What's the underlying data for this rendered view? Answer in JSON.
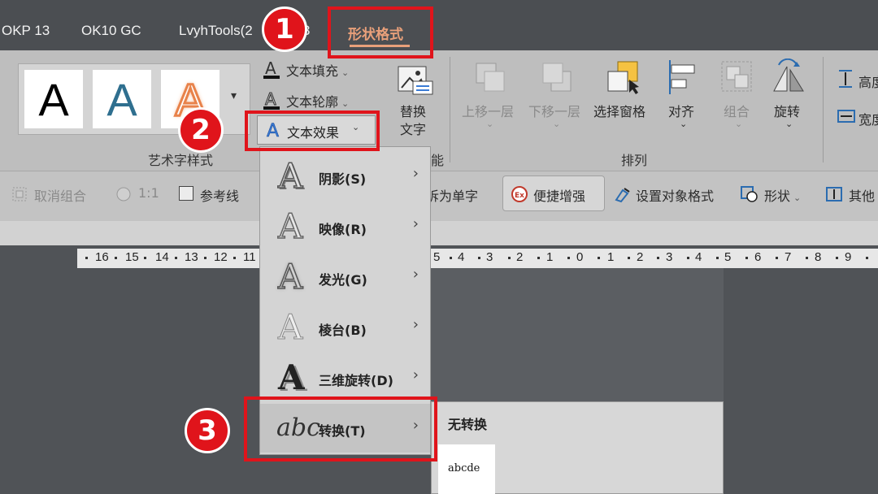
{
  "tabs": [
    "OKP 13",
    "OK10 GC",
    "LvyhTools(2",
    "3",
    "形状格式"
  ],
  "active_tab": "形状格式",
  "ribbon": {
    "wordart_group_label": "艺术字样式",
    "text_fill": "文本填充",
    "text_outline": "文本轮廓",
    "text_effects": "文本效果",
    "replace_text": [
      "替换",
      "文字"
    ],
    "partial_group_label": "能",
    "bring_forward": "上移一层",
    "send_backward": "下移一层",
    "selection_pane": "选择窗格",
    "align": "对齐",
    "group": "组合",
    "rotate": "旋转",
    "arrange_label": "排列",
    "height": "高度",
    "width": "宽度",
    "wordart_samples": [
      "A",
      "A",
      "A"
    ]
  },
  "toolbar2": {
    "ungroup": "取消组合",
    "ratio": "1:1",
    "guides": "参考线",
    "split_chars": "拆为单字",
    "quick_enhance": "便捷增强",
    "set_format": "设置对象格式",
    "shape": "形状",
    "other": "其他"
  },
  "ruler_left": [
    "16",
    "15",
    "14",
    "13",
    "12",
    "11"
  ],
  "ruler_right": [
    "5",
    "4",
    "3",
    "2",
    "1",
    "0",
    "1",
    "2",
    "3",
    "4",
    "5",
    "6",
    "7",
    "8",
    "9"
  ],
  "menu_items": [
    {
      "label": "阴影(S)",
      "glyph": "A"
    },
    {
      "label": "映像(R)",
      "glyph": "A"
    },
    {
      "label": "发光(G)",
      "glyph": "A"
    },
    {
      "label": "棱台(B)",
      "glyph": "A"
    },
    {
      "label": "三维旋转(D)",
      "glyph": "A"
    },
    {
      "label": "转换(T)",
      "glyph": "abc"
    }
  ],
  "submenu": {
    "title": "无转换",
    "sample": "abcde"
  },
  "callouts": [
    "1",
    "2",
    "3"
  ],
  "colors": {
    "accent_red": "#e0141b",
    "active_tab": "#e9a07a",
    "ribbon_bg": "#bebebe"
  }
}
